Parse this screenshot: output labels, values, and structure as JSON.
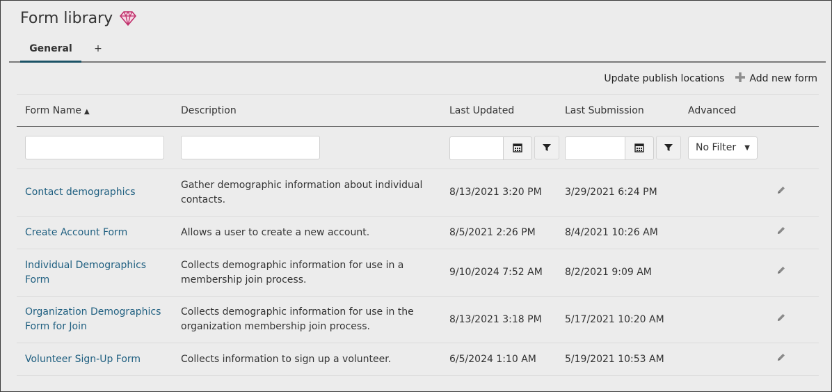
{
  "page": {
    "title": "Form library",
    "icon": "gem-icon",
    "accent": "#c0306b"
  },
  "tabs": [
    {
      "label": "General",
      "active": true
    },
    {
      "label": "+",
      "active": false
    }
  ],
  "actions": {
    "update_label": "Update publish locations",
    "add_label": "Add new form",
    "add_icon": "plus-icon"
  },
  "table": {
    "columns": {
      "name": "Form Name",
      "description": "Description",
      "last_updated": "Last Updated",
      "last_submission": "Last Submission",
      "advanced": "Advanced"
    },
    "sort": {
      "column": "name",
      "direction": "ascending"
    },
    "filters": {
      "name_value": "",
      "description_value": "",
      "last_updated_value": "",
      "last_submission_value": "",
      "advanced_selected": "No Filter"
    },
    "rows": [
      {
        "name_l1": "Contact demographics",
        "name_l2": "",
        "desc_l1": "Gather demographic information about individual",
        "desc_l2": "contacts.",
        "updated": "8/13/2021 3:20 PM",
        "submission": "3/29/2021 6:24 PM"
      },
      {
        "name_l1": "Create Account Form",
        "name_l2": "",
        "desc_l1": "Allows a user to create a new account.",
        "desc_l2": "",
        "updated": "8/5/2021 2:26 PM",
        "submission": "8/4/2021 10:26 AM"
      },
      {
        "name_l1": "Individual Demographics",
        "name_l2": "Form",
        "desc_l1": "Collects demographic information for use in a",
        "desc_l2": "membership join process.",
        "updated": "9/10/2024 7:52 AM",
        "submission": "8/2/2021 9:09 AM"
      },
      {
        "name_l1": "Organization Demographics",
        "name_l2": "Form for Join",
        "desc_l1": "Collects demographic information for use in the",
        "desc_l2": "organization membership join process.",
        "updated": "8/13/2021 3:18 PM",
        "submission": "5/17/2021 10:20 AM"
      },
      {
        "name_l1": "Volunteer Sign-Up Form",
        "name_l2": "",
        "desc_l1": "Collects information to sign up a volunteer.",
        "desc_l2": "",
        "updated": "6/5/2024 1:10 AM",
        "submission": "5/19/2021 10:53 AM"
      }
    ]
  },
  "colors": {
    "link": "#1f5f80",
    "tab_underline": "#1c5366",
    "background": "#ececec"
  }
}
